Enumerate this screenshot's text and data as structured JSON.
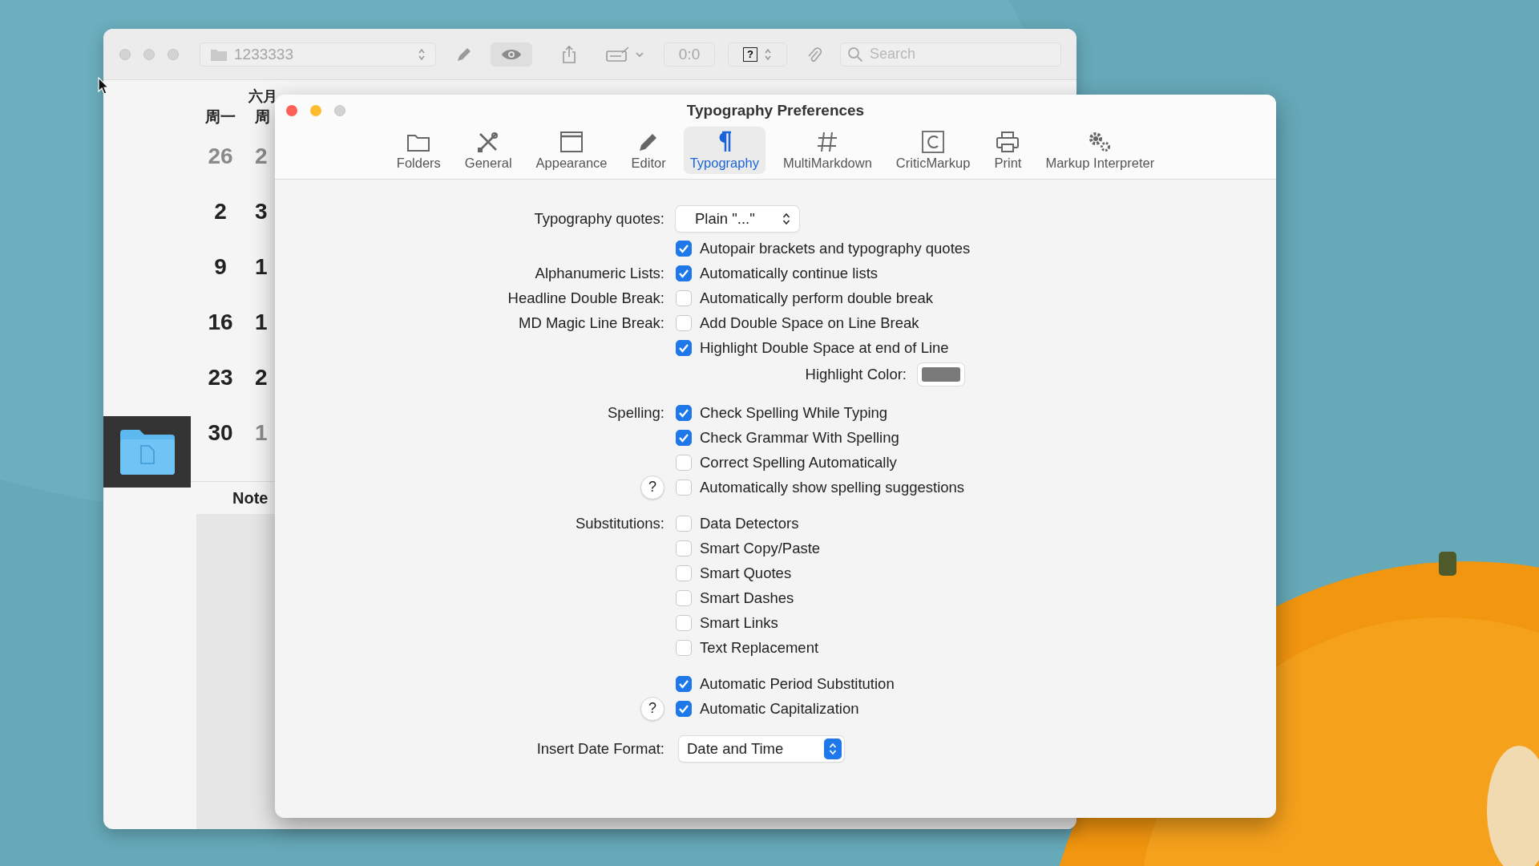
{
  "back_window": {
    "toolbar": {
      "path": "1233333",
      "preview_toggle": {
        "selected": true
      },
      "counter": "0:0",
      "help": "?",
      "search": {
        "placeholder": "Search"
      }
    },
    "folder_item": {
      "selected": true
    },
    "calendar": {
      "month": "六月",
      "weekdays": [
        "周一",
        "周"
      ],
      "weeks": [
        [
          {
            "day": "26",
            "other_month": true
          },
          {
            "day": "2",
            "other_month": true
          }
        ],
        [
          {
            "day": "2",
            "other_month": false
          },
          {
            "day": "3",
            "other_month": false
          }
        ],
        [
          {
            "day": "9",
            "other_month": false
          },
          {
            "day": "1",
            "other_month": false
          }
        ],
        [
          {
            "day": "16",
            "other_month": false
          },
          {
            "day": "1",
            "other_month": false
          }
        ],
        [
          {
            "day": "23",
            "other_month": false
          },
          {
            "day": "2",
            "other_month": false
          }
        ],
        [
          {
            "day": "30",
            "other_month": false
          },
          {
            "day": "1",
            "other_month": true
          }
        ]
      ]
    },
    "notes_heading": "Note"
  },
  "preferences": {
    "title": "Typography Preferences",
    "tabs": [
      {
        "label": "Folders",
        "selected": false
      },
      {
        "label": "General",
        "selected": false
      },
      {
        "label": "Appearance",
        "selected": false
      },
      {
        "label": "Editor",
        "selected": false
      },
      {
        "label": "Typography",
        "selected": true
      },
      {
        "label": "MultiMarkdown",
        "selected": false
      },
      {
        "label": "CriticMarkup",
        "selected": false
      },
      {
        "label": "Print",
        "selected": false
      },
      {
        "label": "Markup Interpreter",
        "selected": false
      }
    ],
    "sections": [
      {
        "rows": [
          {
            "kind": "popup",
            "label": "Typography quotes:",
            "value": "Plain \"...\"",
            "accent": false
          },
          {
            "kind": "checkbox",
            "text": "Autopair brackets and typography quotes",
            "checked": true
          },
          {
            "kind": "checkbox",
            "label": "Alphanumeric Lists:",
            "text": "Automatically continue lists",
            "checked": true
          },
          {
            "kind": "checkbox",
            "label": "Headline Double Break:",
            "text": "Automatically perform double break",
            "checked": false
          },
          {
            "kind": "checkbox",
            "label": "MD Magic Line Break:",
            "text": "Add Double Space on Line Break",
            "checked": false
          },
          {
            "kind": "checkbox",
            "text": "Highlight Double Space at end of Line",
            "checked": true
          },
          {
            "kind": "color",
            "text": "Highlight Color:",
            "color": "#7a7a7a"
          }
        ]
      },
      {
        "rows": [
          {
            "kind": "checkbox",
            "label": "Spelling:",
            "text": "Check Spelling While Typing",
            "checked": true
          },
          {
            "kind": "checkbox",
            "text": "Check Grammar With Spelling",
            "checked": true
          },
          {
            "kind": "checkbox",
            "text": "Correct Spelling Automatically",
            "checked": false
          },
          {
            "kind": "checkbox",
            "help": "?",
            "text": "Automatically show spelling suggestions",
            "checked": false
          }
        ]
      },
      {
        "rows": [
          {
            "kind": "checkbox",
            "label": "Substitutions:",
            "text": "Data Detectors",
            "checked": false
          },
          {
            "kind": "checkbox",
            "text": "Smart Copy/Paste",
            "checked": false
          },
          {
            "kind": "checkbox",
            "text": "Smart Quotes",
            "checked": false
          },
          {
            "kind": "checkbox",
            "text": "Smart Dashes",
            "checked": false
          },
          {
            "kind": "checkbox",
            "text": "Smart Links",
            "checked": false
          },
          {
            "kind": "checkbox",
            "text": "Text Replacement",
            "checked": false
          }
        ]
      },
      {
        "rows": [
          {
            "kind": "checkbox",
            "text": "Automatic Period Substitution",
            "checked": true
          },
          {
            "kind": "checkbox",
            "help": "?",
            "text": "Automatic Capitalization",
            "checked": true
          }
        ]
      },
      {
        "rows": [
          {
            "kind": "popup",
            "label": "Insert Date Format:",
            "value": "Date and Time",
            "accent": true
          }
        ]
      }
    ]
  }
}
